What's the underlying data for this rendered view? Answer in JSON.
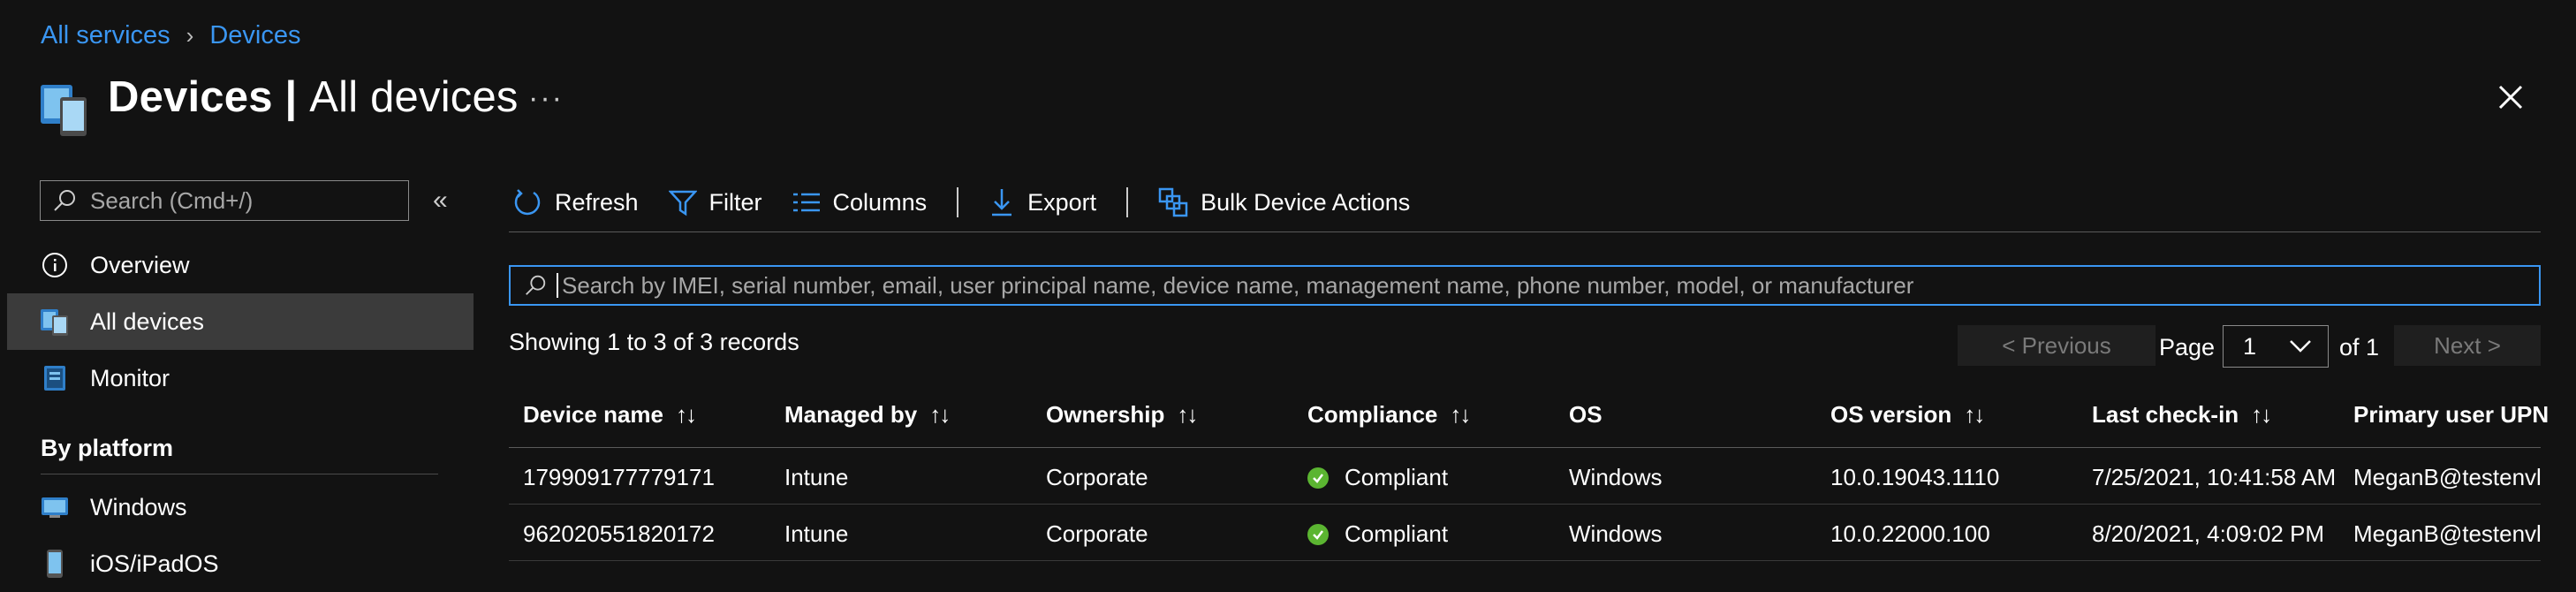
{
  "breadcrumb": {
    "items": [
      "All services",
      "Devices"
    ]
  },
  "header": {
    "title_bold": "Devices",
    "title_sep": " | ",
    "title_rest": "All devices",
    "more": "···"
  },
  "sidebar": {
    "search_placeholder": "Search (Cmd+/)",
    "collapse": "«",
    "items": [
      {
        "label": "Overview",
        "icon": "info-icon"
      },
      {
        "label": "All devices",
        "icon": "devices-icon",
        "selected": true
      },
      {
        "label": "Monitor",
        "icon": "monitor-icon"
      }
    ],
    "section_title": "By platform",
    "platform_items": [
      {
        "label": "Windows",
        "icon": "windows-icon"
      },
      {
        "label": "iOS/iPadOS",
        "icon": "ios-icon"
      }
    ]
  },
  "toolbar": {
    "refresh": "Refresh",
    "filter": "Filter",
    "columns": "Columns",
    "export": "Export",
    "bulk": "Bulk Device Actions"
  },
  "search": {
    "placeholder": "Search by IMEI, serial number, email, user principal name, device name, management name, phone number, model, or manufacturer"
  },
  "records": {
    "text": "Showing 1 to 3 of 3 records"
  },
  "pagination": {
    "previous": "< Previous",
    "page_label": "Page",
    "page_value": "1",
    "of_label": "of 1",
    "next": "Next >"
  },
  "table": {
    "columns": [
      "Device name",
      "Managed by",
      "Ownership",
      "Compliance",
      "OS",
      "OS version",
      "Last check-in",
      "Primary user UPN"
    ],
    "sortable": [
      true,
      true,
      true,
      true,
      false,
      true,
      true,
      false
    ],
    "sort_glyph": "↑↓",
    "rows": [
      [
        "179909177779171",
        "Intune",
        "Corporate",
        "Compliant",
        "Windows",
        "10.0.19043.1110",
        "7/25/2021, 10:41:58 AM",
        "MeganB@testenvlab"
      ],
      [
        "962020551820172",
        "Intune",
        "Corporate",
        "Compliant",
        "Windows",
        "10.0.22000.100",
        "8/20/2021, 4:09:02 PM",
        "MeganB@testenvlab"
      ]
    ]
  },
  "colors": {
    "accent": "#3a96f2",
    "compliant": "#5bb531",
    "selected_bg": "#3b3b3b",
    "background": "#121212"
  }
}
